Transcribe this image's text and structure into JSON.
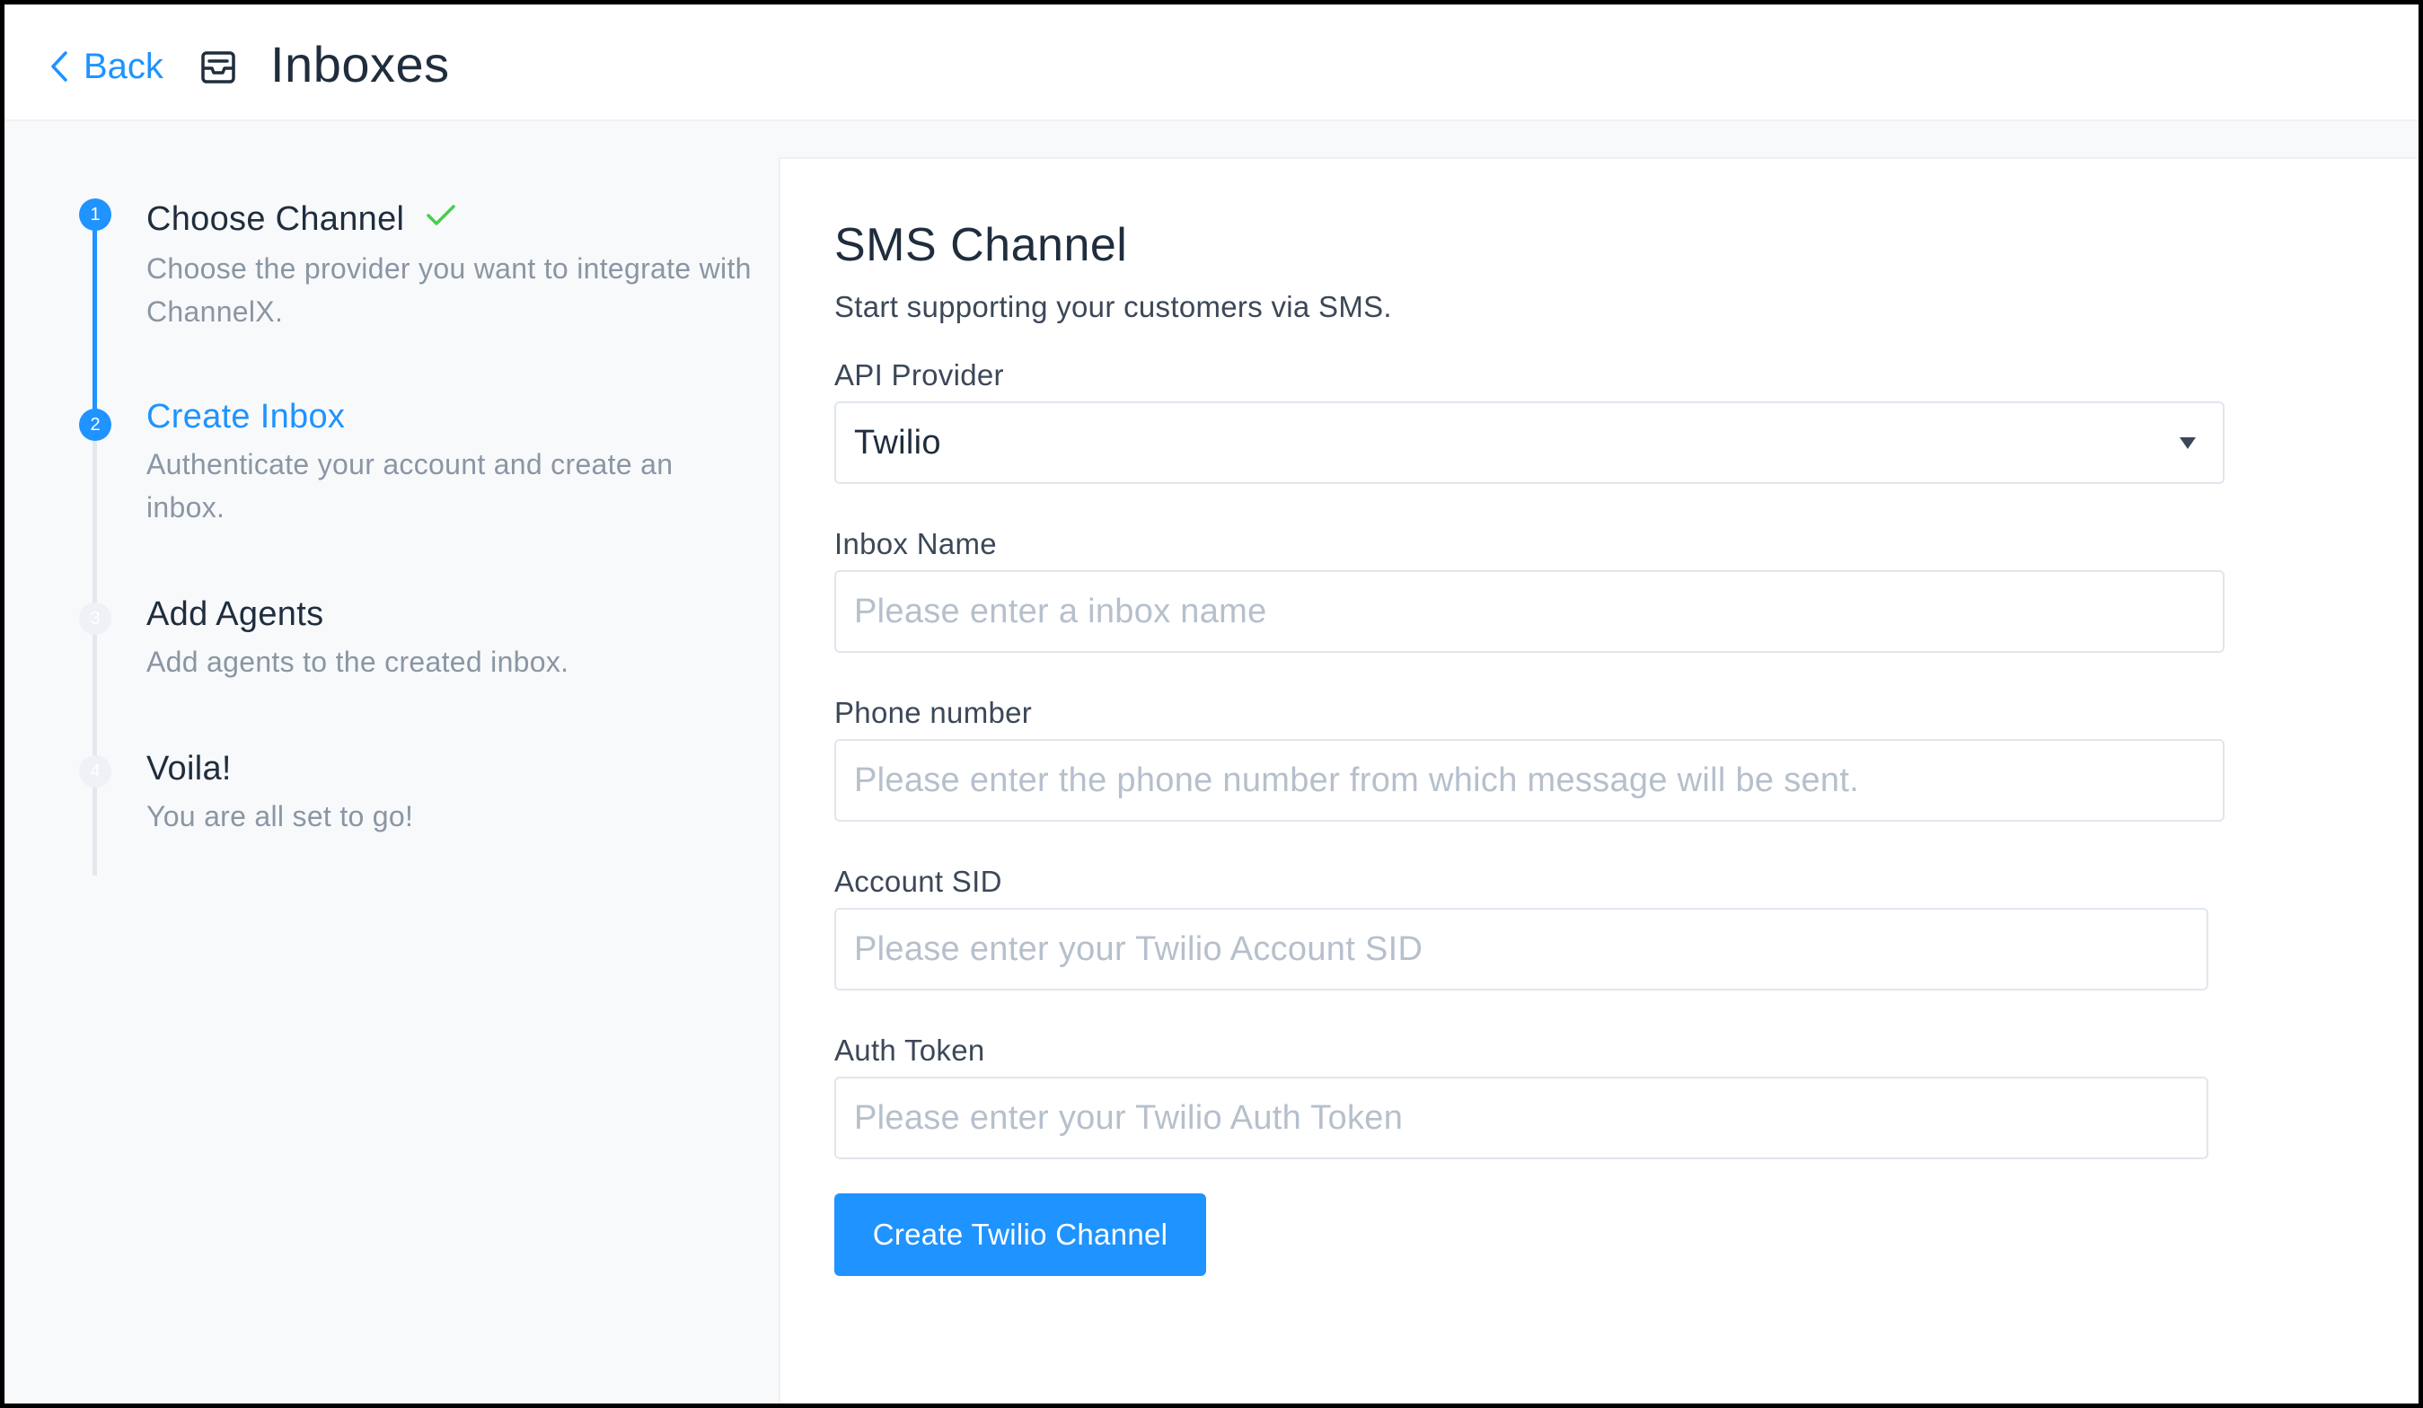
{
  "header": {
    "back_label": "Back",
    "title": "Inboxes",
    "back_icon": "chevron-left-icon",
    "title_icon": "inbox-icon"
  },
  "steps": [
    {
      "number": "1",
      "title": "Choose Channel",
      "description": "Choose the provider you want to integrate with ChannelX.",
      "status": "completed"
    },
    {
      "number": "2",
      "title": "Create Inbox",
      "description": "Authenticate your account and create an inbox.",
      "status": "current"
    },
    {
      "number": "3",
      "title": "Add Agents",
      "description": "Add agents to the created inbox.",
      "status": "upcoming"
    },
    {
      "number": "4",
      "title": "Voila!",
      "description": "You are all set to go!",
      "status": "upcoming"
    }
  ],
  "form": {
    "title": "SMS Channel",
    "subtitle": "Start supporting your customers via SMS.",
    "api_provider": {
      "label": "API Provider",
      "value": "Twilio"
    },
    "inbox_name": {
      "label": "Inbox Name",
      "value": "",
      "placeholder": "Please enter a inbox name"
    },
    "phone_number": {
      "label": "Phone number",
      "value": "",
      "placeholder": "Please enter the phone number from which message will be sent."
    },
    "account_sid": {
      "label": "Account SID",
      "value": "",
      "placeholder": "Please enter your Twilio Account SID"
    },
    "auth_token": {
      "label": "Auth Token",
      "value": "",
      "placeholder": "Please enter your Twilio Auth Token"
    },
    "submit_label": "Create Twilio Channel"
  },
  "colors": {
    "accent": "#1f93ff",
    "success": "#44ce4b",
    "text": "#1f2d3d",
    "muted": "#8a96a3"
  }
}
